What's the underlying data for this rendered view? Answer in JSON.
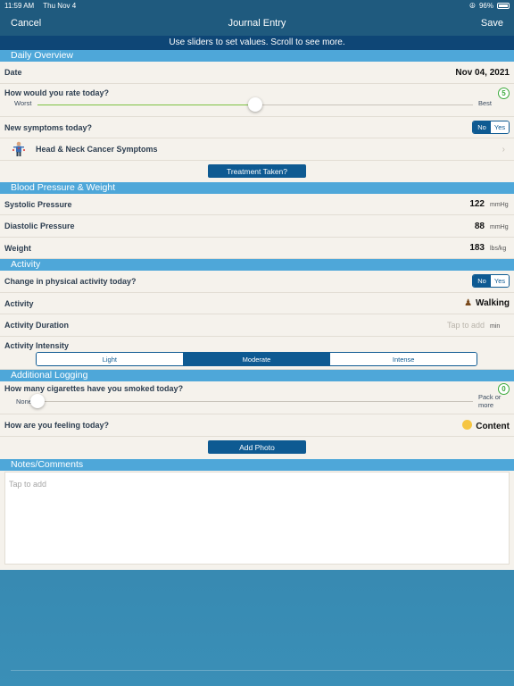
{
  "status": {
    "time": "11:59 AM",
    "date": "Thu Nov 4",
    "battery": "96%"
  },
  "nav": {
    "cancel": "Cancel",
    "title": "Journal Entry",
    "save": "Save"
  },
  "hint": "Use sliders to set values. Scroll to see more.",
  "daily": {
    "header": "Daily Overview",
    "date_label": "Date",
    "date_value": "Nov 04, 2021",
    "rate_label": "How would you rate today?",
    "rate_value": "5",
    "rate_fraction": 0.5,
    "rate_min": "Worst",
    "rate_max": "Best",
    "symptoms_label": "New symptoms today?",
    "toggle_no": "No",
    "toggle_yes": "Yes",
    "symptoms_item": "Head & Neck Cancer Symptoms",
    "treatment_button": "Treatment Taken?"
  },
  "bp": {
    "header": "Blood Pressure & Weight",
    "systolic_label": "Systolic Pressure",
    "systolic_value": "122",
    "systolic_unit": "mmHg",
    "diastolic_label": "Diastolic Pressure",
    "diastolic_value": "88",
    "diastolic_unit": "mmHg",
    "weight_label": "Weight",
    "weight_value": "183",
    "weight_unit": "lbs/kg"
  },
  "activity": {
    "header": "Activity",
    "change_label": "Change in physical activity today?",
    "toggle_no": "No",
    "toggle_yes": "Yes",
    "activity_label": "Activity",
    "activity_value": "Walking",
    "duration_label": "Activity Duration",
    "duration_placeholder": "Tap to add",
    "duration_unit": "min",
    "intensity_label": "Activity Intensity",
    "intensity_options": [
      "Light",
      "Moderate",
      "Intense"
    ],
    "intensity_selected": "Moderate"
  },
  "logging": {
    "header": "Additional Logging",
    "cigs_label": "How many cigarettes have you smoked today?",
    "cigs_value": "0",
    "cigs_fraction": 0,
    "cigs_min": "None",
    "cigs_max": "Pack or more",
    "feeling_label": "How are you feeling today?",
    "feeling_value": "Content",
    "photo_button": "Add Photo"
  },
  "notes": {
    "header": "Notes/Comments",
    "placeholder": "Tap to add"
  },
  "colors": {
    "nav": "#1f5a7e",
    "hint_bar": "#0e4676",
    "section": "#4ea7d9",
    "accent": "#0e5a92",
    "slider": "#7cc242"
  }
}
